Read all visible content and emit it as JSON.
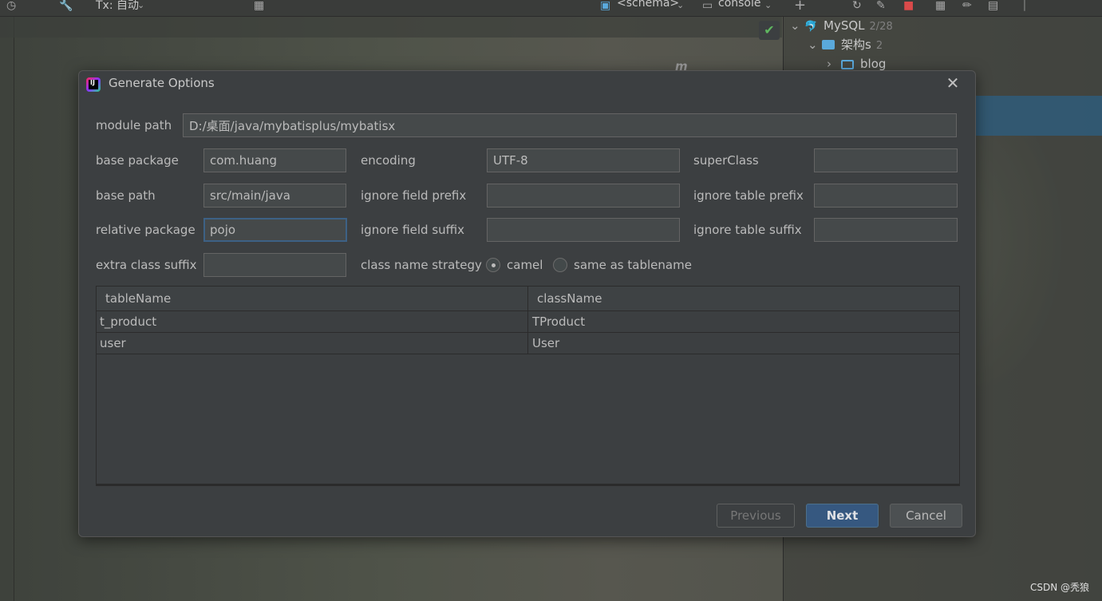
{
  "ide": {
    "toolbar": {
      "tx_mode": "Tx: 自动",
      "schema_selector": "<schema>",
      "console_selector": "console"
    },
    "db_tree": {
      "connection": {
        "name": "MySQL",
        "count": "2/28"
      },
      "schema": {
        "name": "架构s",
        "count": "2"
      },
      "database": {
        "name": "blog"
      }
    },
    "watermark": "CSDN @秃狼"
  },
  "dialog": {
    "title": "Generate Options",
    "fields": {
      "module_path": {
        "label": "module path",
        "value": "D:/桌面/java/mybatisplus/mybatisx"
      },
      "base_package": {
        "label": "base package",
        "value": "com.huang"
      },
      "encoding": {
        "label": "encoding",
        "value": "UTF-8"
      },
      "super_class": {
        "label": "superClass",
        "value": ""
      },
      "base_path": {
        "label": "base path",
        "value": "src/main/java"
      },
      "ignore_field_prefix": {
        "label": "ignore field prefix",
        "value": ""
      },
      "ignore_table_prefix": {
        "label": "ignore table prefix",
        "value": ""
      },
      "relative_package": {
        "label": "relative package",
        "value": "pojo"
      },
      "ignore_field_suffix": {
        "label": "ignore field suffix",
        "value": ""
      },
      "ignore_table_suffix": {
        "label": "ignore table suffix",
        "value": ""
      },
      "extra_class_suffix": {
        "label": "extra class suffix",
        "value": ""
      }
    },
    "class_name_strategy": {
      "label": "class name strategy",
      "options": [
        "camel",
        "same as tablename"
      ],
      "selected": "camel"
    },
    "table": {
      "columns": [
        "tableName",
        "className"
      ],
      "rows": [
        [
          "t_product",
          "TProduct"
        ],
        [
          "user",
          "User"
        ]
      ]
    },
    "buttons": {
      "previous": "Previous",
      "next": "Next",
      "cancel": "Cancel"
    }
  }
}
